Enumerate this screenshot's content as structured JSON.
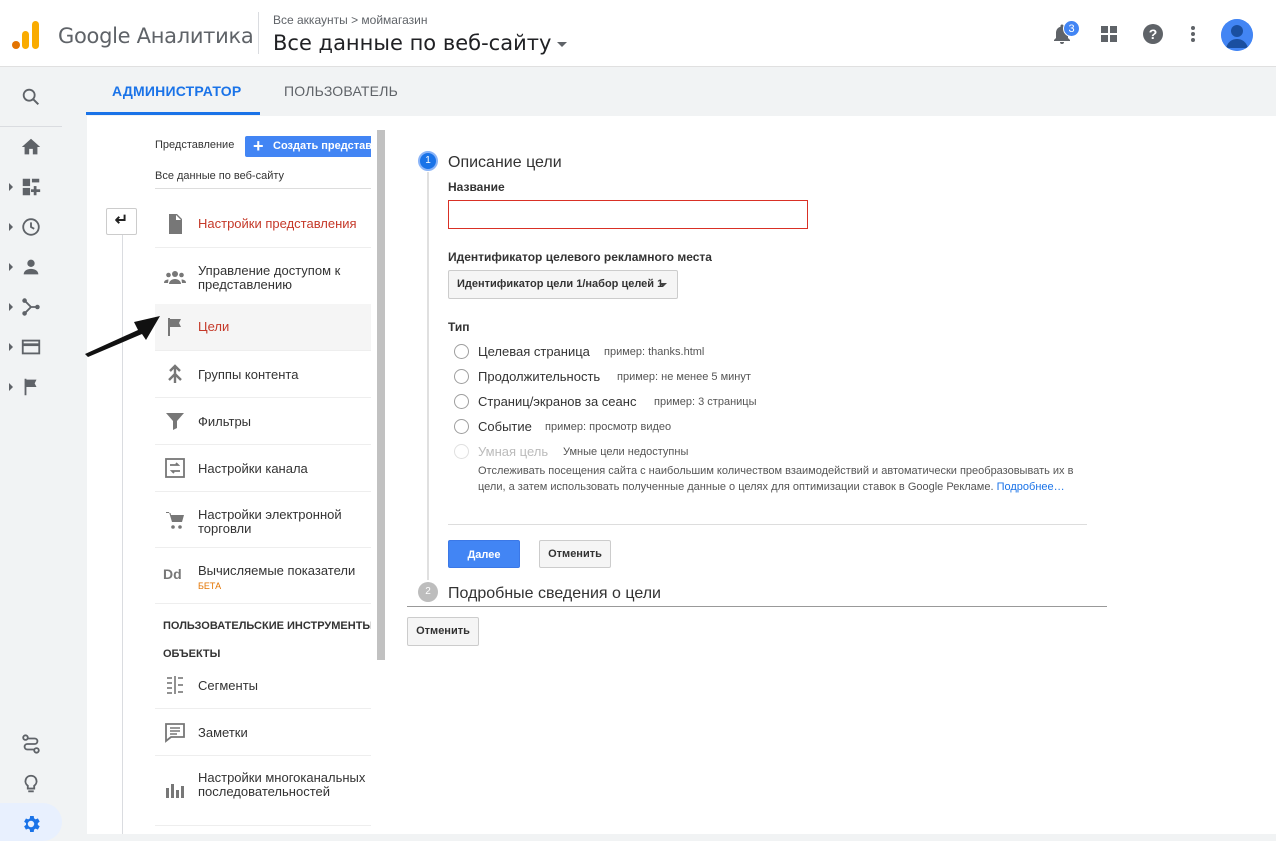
{
  "header": {
    "brand": "Google Аналитика",
    "breadcrumb": "Все аккаунты > моймагазин",
    "view_selector": "Все данные по веб-сайту",
    "notifications_count": "3",
    "icons": [
      "notifications-icon",
      "apps-icon",
      "help-icon",
      "more-vert-icon",
      "account-avatar"
    ]
  },
  "rail": {
    "icons": [
      "search-icon",
      "home-icon",
      "dashboard-icon",
      "clock-icon",
      "person-icon",
      "fork-icon",
      "card-icon",
      "flag-icon",
      "path-icon",
      "lightbulb-icon",
      "settings-icon"
    ],
    "active": "settings-icon"
  },
  "tabs": {
    "admin": "АДМИНИСТРАТОР",
    "user": "ПОЛЬЗОВАТЕЛЬ",
    "active": "admin"
  },
  "column": {
    "view_label": "Представление",
    "create_button": "Создать представле",
    "view_name": "Все данные по веб-сайту",
    "items": [
      {
        "label": "Настройки представления",
        "icon": "document-icon"
      },
      {
        "label": "Управление доступом к представлению",
        "icon": "people-icon"
      },
      {
        "label": "Цели",
        "icon": "flag-icon"
      },
      {
        "label": "Группы контента",
        "icon": "content-group-icon"
      },
      {
        "label": "Фильтры",
        "icon": "filter-icon"
      },
      {
        "label": "Настройки канала",
        "icon": "channel-icon"
      },
      {
        "label": "Настройки электронной торговли",
        "icon": "cart-icon"
      },
      {
        "label": "Вычисляемые показатели",
        "icon": "dd-icon",
        "badge": "БЕТА"
      }
    ],
    "section_title_1": "ПОЛЬЗОВАТЕЛЬСКИЕ ИНСТРУМЕНТЫ И",
    "section_title_2": "ОБЪЕКТЫ",
    "tools": [
      {
        "label": "Сегменты",
        "icon": "segments-icon"
      },
      {
        "label": "Заметки",
        "icon": "notes-icon"
      },
      {
        "label": "Настройки многоканальных последовательностей",
        "icon": "bar-chart-icon"
      }
    ]
  },
  "form": {
    "step1_number": "1",
    "step1_title": "Описание цели",
    "name_label": "Название",
    "name_value": "",
    "slot_label": "Идентификатор целевого рекламного места",
    "slot_value": "Идентификатор цели 1/набор целей 1",
    "type_label": "Тип",
    "types": [
      {
        "label": "Целевая страница",
        "hint": "пример: thanks.html",
        "disabled": false
      },
      {
        "label": "Продолжительность",
        "hint": "пример: не менее 5 минут",
        "disabled": false
      },
      {
        "label": "Страниц/экранов за сеанс",
        "hint": "пример: 3 страницы",
        "disabled": false
      },
      {
        "label": "Событие",
        "hint": "пример: просмотр видео",
        "disabled": false
      },
      {
        "label": "Умная цель",
        "hint": "Умные цели недоступны",
        "disabled": true
      }
    ],
    "smart_description": "Отслеживать посещения сайта с наибольшим количеством взаимодействий и автоматически преобразовывать их в цели, а затем использовать полученные данные о целях для оптимизации ставок в Google Рекламе.",
    "smart_more_link": "Подробнее…",
    "next_button": "Далее",
    "cancel_button": "Отменить",
    "step2_number": "2",
    "step2_title": "Подробные сведения о цели",
    "bottom_cancel_button": "Отменить"
  },
  "colors": {
    "accent": "#1a73e8",
    "primary_button": "#4285f4",
    "error": "#d93025",
    "active_item_text": "#c53929"
  }
}
